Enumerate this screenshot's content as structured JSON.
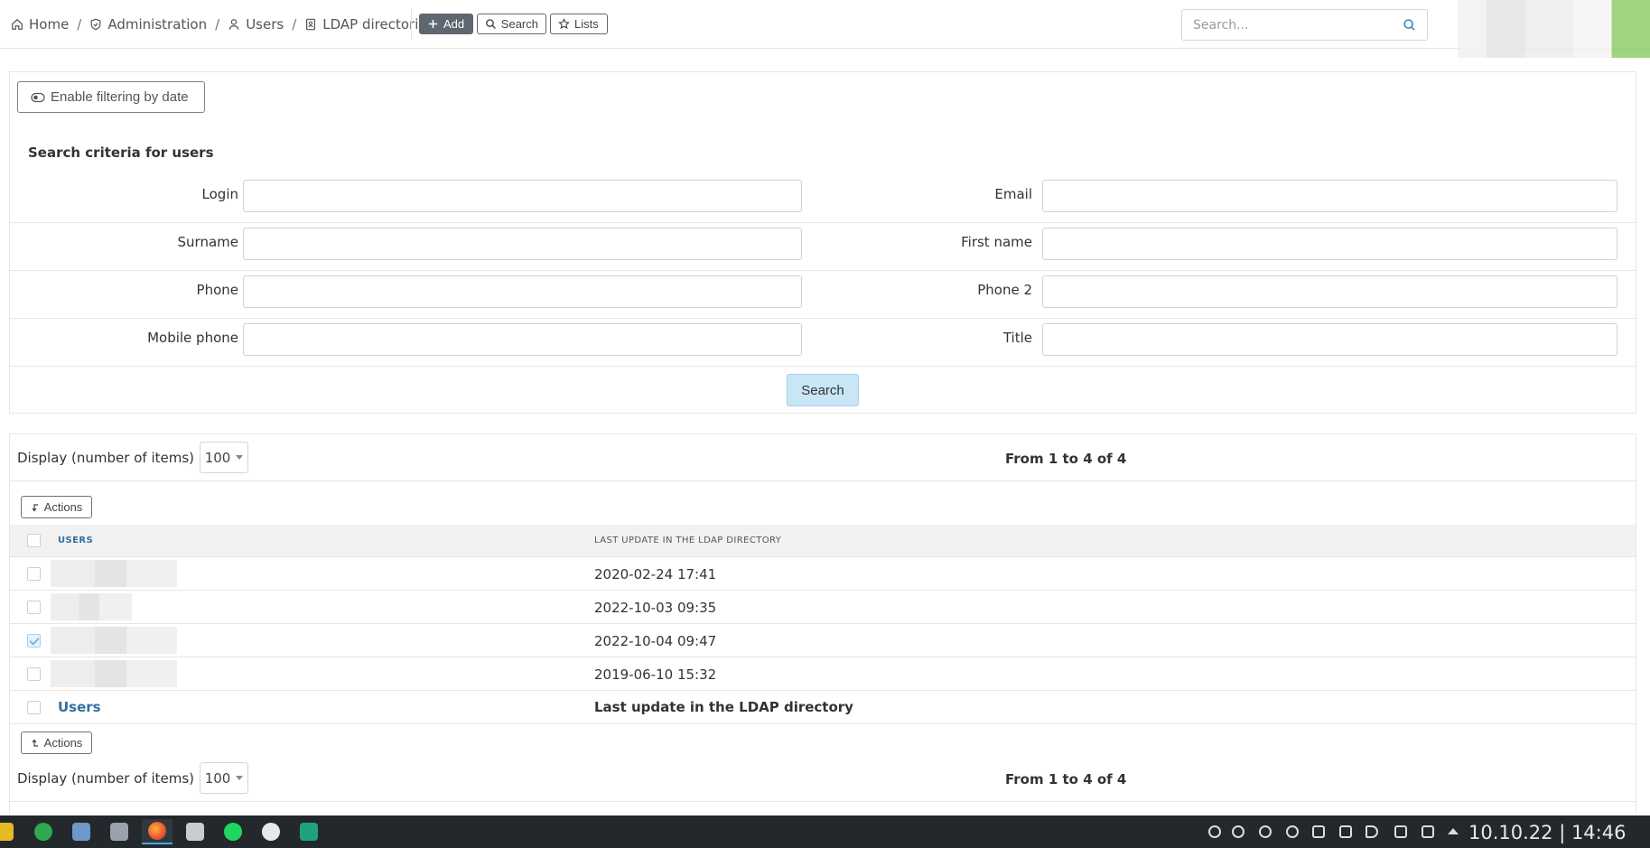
{
  "breadcrumb": [
    "Home",
    "Administration",
    "Users",
    "LDAP directories"
  ],
  "toolbar": {
    "add_label": "Add",
    "search_label": "Search",
    "lists_label": "Lists"
  },
  "top_search": {
    "placeholder": "Search..."
  },
  "filter": {
    "date_toggle_label": "Enable filtering by date",
    "criteria_title": "Search criteria for users",
    "fields": {
      "login": "Login",
      "email": "Email",
      "surname": "Surname",
      "first_name": "First name",
      "phone": "Phone",
      "phone2": "Phone 2",
      "mobile": "Mobile phone",
      "title": "Title"
    },
    "search_button": "Search"
  },
  "list": {
    "display_label": "Display (number of items)",
    "page_size": "100",
    "pager_text": "From 1 to 4 of 4",
    "actions_label": "Actions",
    "columns": [
      "Users",
      "Last update in the LDAP directory"
    ],
    "rows": [
      {
        "last_update": "2020-02-24 17:41",
        "checked": false
      },
      {
        "last_update": "2022-10-03 09:35",
        "checked": false
      },
      {
        "last_update": "2022-10-04 09:47",
        "checked": true
      },
      {
        "last_update": "2019-06-10 15:32",
        "checked": false
      }
    ],
    "footer": {
      "users": "Users",
      "last_update": "Last update in the LDAP directory"
    }
  },
  "taskbar": {
    "clock": "10.10.22 | 14:46"
  }
}
